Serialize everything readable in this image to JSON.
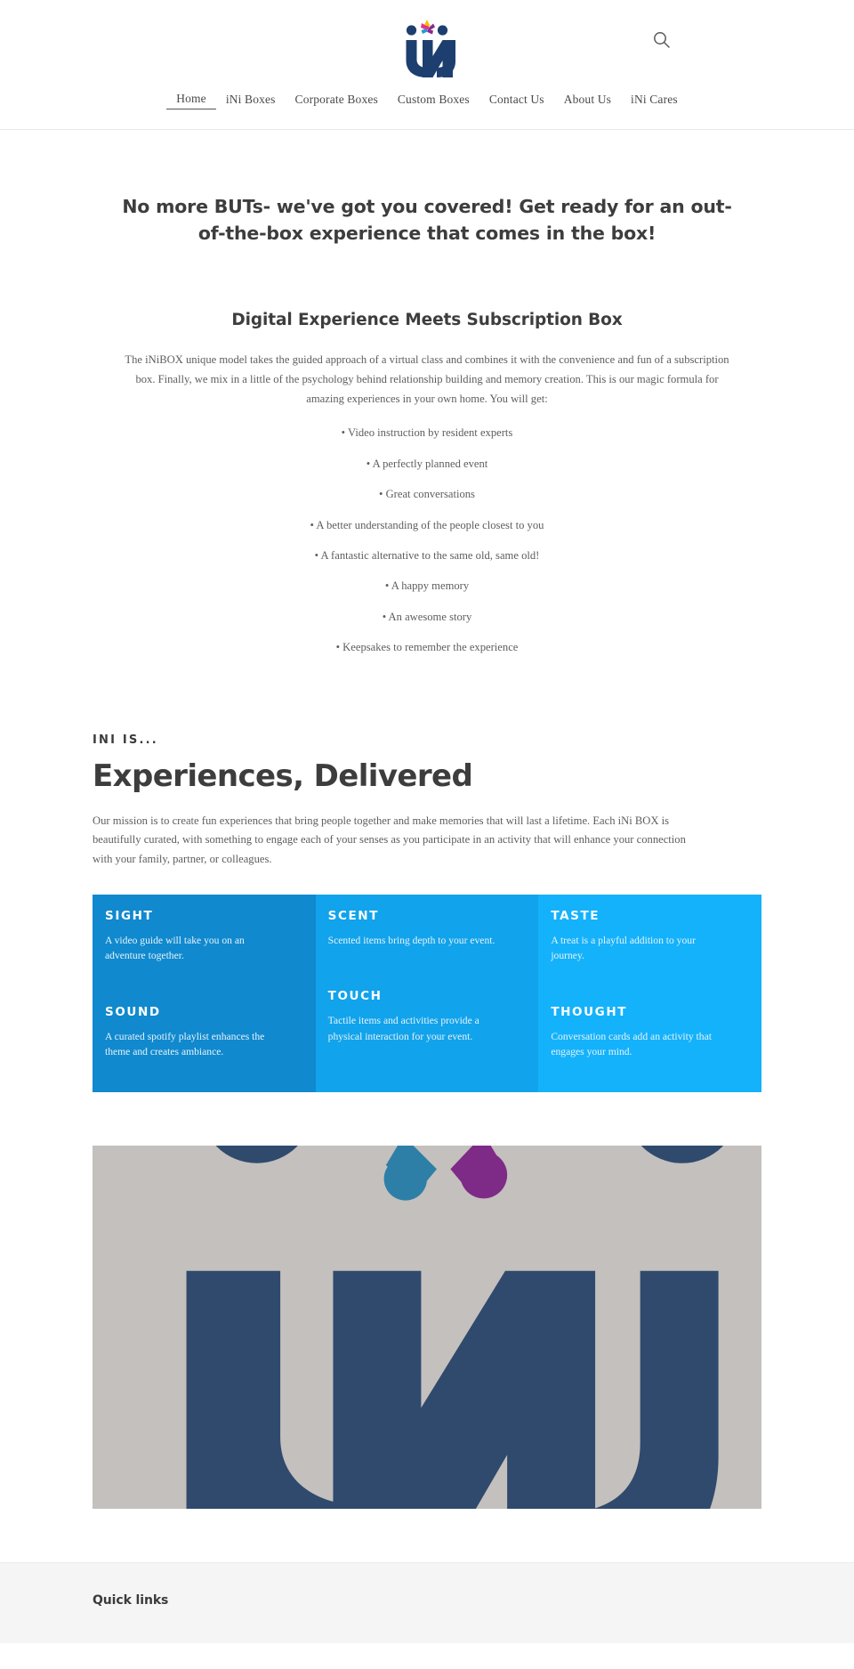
{
  "header": {
    "logo_alt": "iNi",
    "search_icon": "search-icon",
    "nav": [
      {
        "label": "Home",
        "active": true
      },
      {
        "label": "iNi Boxes",
        "active": false
      },
      {
        "label": "Corporate Boxes",
        "active": false
      },
      {
        "label": "Custom Boxes",
        "active": false
      },
      {
        "label": "Contact Us",
        "active": false
      },
      {
        "label": "About Us",
        "active": false
      },
      {
        "label": "iNi Cares",
        "active": false
      }
    ]
  },
  "hero": {
    "headline": "No more BUTs- we've got you covered! Get ready for an out-of-the-box experience that comes in the box!"
  },
  "intro": {
    "heading": "Digital Experience Meets Subscription Box",
    "paragraph": "The iNiBOX unique model takes the guided approach of a virtual class and combines it with the convenience and fun of a subscription box. Finally, we mix in a little of the psychology behind relationship building and memory creation. This is our magic formula for amazing experiences in your own home. You will get:",
    "bullets": [
      "• Video instruction by resident experts",
      "• A perfectly planned event",
      "• Great conversations",
      "• A better understanding of the people closest to you",
      "• A fantastic alternative to the same old, same old!",
      "• A happy memory",
      "• An awesome story",
      "• Keepsakes to remember the experience"
    ]
  },
  "mission": {
    "eyebrow": "INI IS...",
    "heading": "Experiences, Delivered",
    "paragraph": "Our mission is to create fun experiences that bring people together and make memories that will last a lifetime. Each iNi BOX is beautifully curated, with something to engage each of your senses as you participate in an activity that will enhance your connection with your family, partner, or colleagues."
  },
  "senses": {
    "columns": [
      {
        "color": "#1089ce",
        "blocks": [
          {
            "title": "SIGHT",
            "desc": "A video guide will take you on an adventure together."
          },
          {
            "title": "SOUND",
            "desc": "A curated spotify playlist enhances the theme and creates ambiance."
          }
        ]
      },
      {
        "color": "#11a3eb",
        "blocks": [
          {
            "title": "SCENT",
            "desc": "Scented items bring depth to your event."
          },
          {
            "title": "TOUCH",
            "desc": "Tactile items and activities provide a physical interaction for your event."
          }
        ]
      },
      {
        "color": "#14b2fb",
        "blocks": [
          {
            "title": "TASTE",
            "desc": "A treat is a playful addition to your journey."
          },
          {
            "title": "THOUGHT",
            "desc": "Conversation cards add an activity that engages your mind."
          }
        ]
      }
    ]
  },
  "banner": {
    "alt": "iNi logo close-up banner",
    "background_color": "#c4c0bd",
    "logo_color": "#2f4a6d"
  },
  "footer": {
    "quick_links_heading": "Quick links"
  }
}
